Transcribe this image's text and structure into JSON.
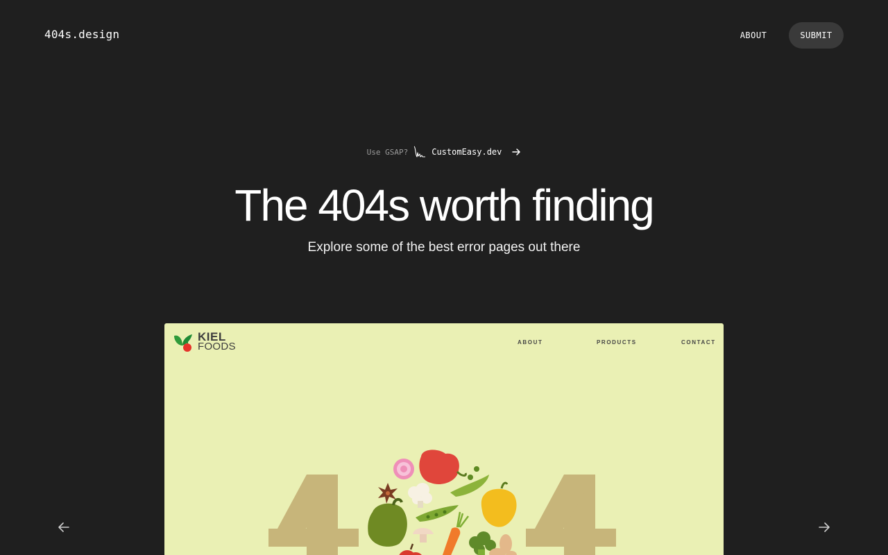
{
  "header": {
    "logo": "404s.design",
    "nav_about": "ABOUT",
    "nav_submit": "SUBMIT"
  },
  "promo": {
    "question": "Use GSAP?",
    "site": "CustomEasy.dev",
    "icons": [
      "ease-curve-icon",
      "arrow-right-icon"
    ]
  },
  "hero": {
    "title": "The 404s worth finding",
    "subtitle": "Explore some of the best error pages out there"
  },
  "carousel": {
    "prev_icon": "arrow-left-icon",
    "next_icon": "arrow-right-icon"
  },
  "preview": {
    "brand_line1": "KIEL",
    "brand_line2": "FOODS",
    "nav": [
      "ABOUT",
      "PRODUCTS",
      "CONTACT"
    ],
    "colors": {
      "background": "#eaf0b4",
      "digits": "#c7b57a",
      "text": "#3d3d3d"
    }
  },
  "colors": {
    "page_background": "#1f1f1f",
    "pill_background": "#3a3a3a",
    "text": "#ffffff",
    "muted_text": "#9a9a9a"
  }
}
